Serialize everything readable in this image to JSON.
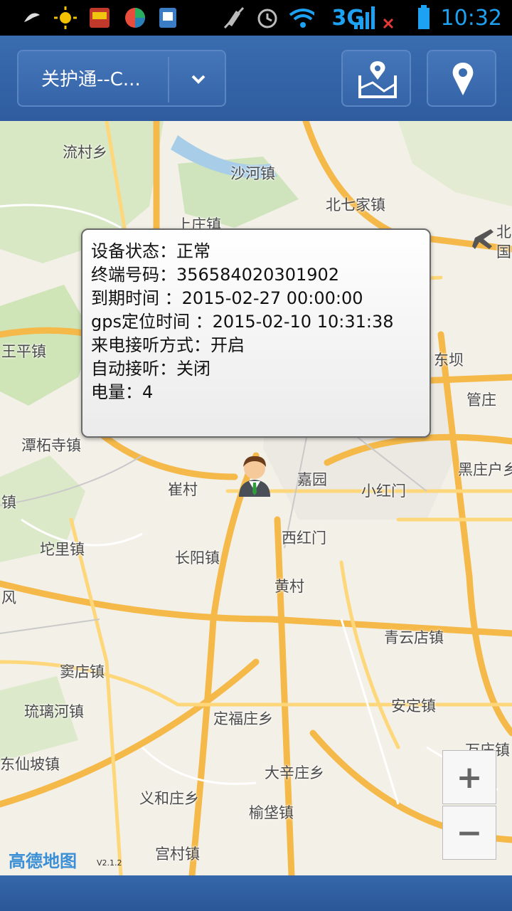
{
  "status_bar": {
    "network": "3G",
    "time": "10:32"
  },
  "header": {
    "device_label": "关护通--C...",
    "map_button_icon": "map-fence-icon",
    "locate_button_icon": "location-pin-icon"
  },
  "popup": {
    "lines": [
      "设备状态：正常",
      "终端号码：356584020301902",
      "到期时间 ：2015-02-27 00:00:00",
      "gps定位时间 ：2015-02-10 10:31:38",
      "来电接听方式：开启",
      "自动接听：关闭",
      "电量：4"
    ]
  },
  "map": {
    "places": [
      "流村乡",
      "沙河镇",
      "北七家镇",
      "上庄镇",
      "北",
      "国",
      "王平镇",
      "东坝",
      "管庄",
      "潭柘寺镇",
      "黑庄户乡",
      "崔村",
      "嘉园",
      "小红门",
      "坨里镇",
      "长阳镇",
      "西红门",
      "风",
      "黄村",
      "青云店镇",
      "窦店镇",
      "琉璃河镇",
      "定福庄乡",
      "安定镇",
      "东仙坡镇",
      "万庄镇",
      "大辛庄乡",
      "义和庄乡",
      "榆垡镇",
      "宫村镇",
      "镇"
    ],
    "logo": "高德地图",
    "version": "V2.1.2"
  },
  "zoom": {
    "in_label": "+",
    "out_label": "−"
  }
}
